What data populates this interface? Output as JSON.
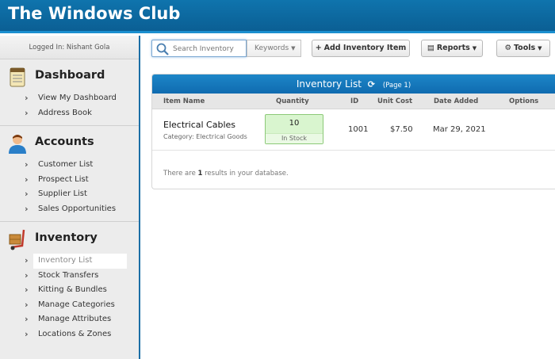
{
  "header": {
    "title": "The Windows Club"
  },
  "sidebar": {
    "logged_in": "Logged In: Nishant Gola",
    "sections": [
      {
        "title": "Dashboard",
        "icon": "notepad-icon",
        "items": [
          "View My Dashboard",
          "Address Book"
        ]
      },
      {
        "title": "Accounts",
        "icon": "user-icon",
        "items": [
          "Customer List",
          "Prospect List",
          "Supplier List",
          "Sales Opportunities"
        ]
      },
      {
        "title": "Inventory",
        "icon": "hand-truck-icon",
        "items": [
          "Inventory List",
          "Stock Transfers",
          "Kitting & Bundles",
          "Manage Categories",
          "Manage Attributes",
          "Locations & Zones"
        ],
        "active_item": "Inventory List"
      }
    ]
  },
  "toolbar": {
    "search_placeholder": "Search Inventory",
    "search_mode": "Keywords",
    "add_label": "Add Inventory Item",
    "reports_label": "Reports",
    "tools_label": "Tools"
  },
  "panel": {
    "title": "Inventory List",
    "page_label": "(Page 1)",
    "columns": [
      "Item Name",
      "Quantity",
      "ID",
      "Unit Cost",
      "Date Added",
      "Options"
    ],
    "rows": [
      {
        "name": "Electrical Cables",
        "category": "Category: Electrical Goods",
        "quantity": "10",
        "stock_status": "In Stock",
        "id": "1001",
        "unit_cost": "$7.50",
        "date_added": "Mar 29, 2021"
      }
    ],
    "results_prefix": "There are",
    "results_count": "1",
    "results_suffix": "results in your database."
  },
  "colors": {
    "header_bg": "#0b5f94",
    "panel_header": "#1d86c8",
    "in_stock_bg": "#d9f5cf"
  }
}
